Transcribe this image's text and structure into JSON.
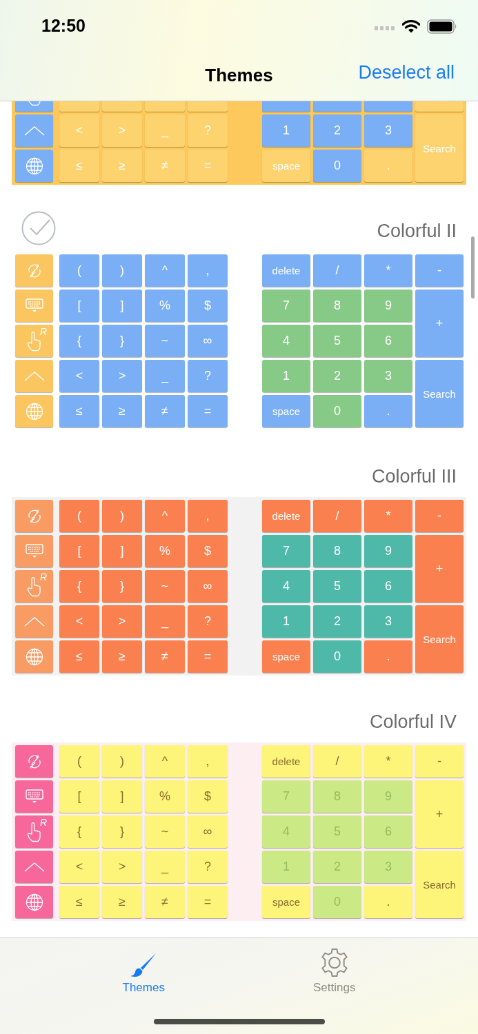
{
  "status_bar": {
    "time": "12:50"
  },
  "nav": {
    "title": "Themes",
    "action": "Deselect all"
  },
  "themes": [
    {
      "panel": {
        "color": "#fdc95c"
      },
      "dark_labels": false,
      "side_keys": [
        {
          "kind": "hand",
          "color": "#7aaff5"
        },
        {
          "kind": "shift",
          "color": "#7aaff5"
        },
        {
          "kind": "globe",
          "color": "#7aaff5"
        }
      ],
      "symbol_rows": [
        [
          {
            "color": "#fdd36f"
          },
          {
            "color": "#fdd36f"
          },
          {
            "color": "#fdd36f"
          },
          {
            "color": "#fdd36f"
          }
        ],
        [
          {
            "label": "<",
            "color": "#fdd36f"
          },
          {
            "label": ">",
            "color": "#fdd36f"
          },
          {
            "label": "_",
            "color": "#fdd36f"
          },
          {
            "label": "?",
            "color": "#fdd36f"
          }
        ],
        [
          {
            "label": "≤",
            "color": "#fdd36f"
          },
          {
            "label": "≥",
            "color": "#fdd36f"
          },
          {
            "label": "≠",
            "color": "#fdd36f"
          },
          {
            "label": "=",
            "color": "#fdd36f"
          }
        ]
      ],
      "numpad": [
        {
          "kind": "digit",
          "color": "#7aaff5"
        },
        {
          "kind": "digit",
          "color": "#7aaff5"
        },
        {
          "kind": "digit",
          "color": "#7aaff5"
        },
        {
          "kind": "other",
          "color": "#fdd36f"
        },
        {
          "kind": "digit",
          "label": "1",
          "color": "#7aaff5"
        },
        {
          "kind": "digit",
          "label": "2",
          "color": "#7aaff5"
        },
        {
          "kind": "digit",
          "label": "3",
          "color": "#7aaff5"
        },
        {
          "kind": "other",
          "label": "Search",
          "tall": true,
          "color": "#fdd36f"
        },
        {
          "kind": "other",
          "label": "space",
          "color": "#fdd36f"
        },
        {
          "kind": "digit",
          "label": "0",
          "color": "#7aaff5"
        },
        {
          "kind": "other",
          "label": ".",
          "color": "#fdd36f"
        }
      ]
    },
    {
      "name": "Colorful II",
      "selected": true,
      "panel": {
        "color": "#ffffff"
      },
      "dark_labels": false,
      "side_keys": [
        {
          "kind": "theme",
          "color": "#fbc65f"
        },
        {
          "kind": "keyboard",
          "color": "#fbc65f"
        },
        {
          "kind": "hand",
          "badge": "R",
          "color": "#fbc65f"
        },
        {
          "kind": "shift",
          "color": "#fbc65f"
        },
        {
          "kind": "globe",
          "color": "#fbc65f"
        }
      ],
      "symbol_rows": [
        [
          {
            "label": "(",
            "color": "#7aaff5"
          },
          {
            "label": ")",
            "color": "#7aaff5"
          },
          {
            "label": "^",
            "color": "#7aaff5"
          },
          {
            "label": ",",
            "color": "#7aaff5"
          }
        ],
        [
          {
            "label": "[",
            "color": "#7aaff5"
          },
          {
            "label": "]",
            "color": "#7aaff5"
          },
          {
            "label": "%",
            "color": "#7aaff5"
          },
          {
            "label": "$",
            "color": "#7aaff5"
          }
        ],
        [
          {
            "label": "{",
            "color": "#7aaff5"
          },
          {
            "label": "}",
            "color": "#7aaff5"
          },
          {
            "label": "~",
            "color": "#7aaff5"
          },
          {
            "label": "∞",
            "color": "#7aaff5"
          }
        ],
        [
          {
            "label": "<",
            "color": "#7aaff5"
          },
          {
            "label": ">",
            "color": "#7aaff5"
          },
          {
            "label": "_",
            "color": "#7aaff5"
          },
          {
            "label": "?",
            "color": "#7aaff5"
          }
        ],
        [
          {
            "label": "≤",
            "color": "#7aaff5"
          },
          {
            "label": "≥",
            "color": "#7aaff5"
          },
          {
            "label": "≠",
            "color": "#7aaff5"
          },
          {
            "label": "=",
            "color": "#7aaff5"
          }
        ]
      ],
      "numpad": [
        {
          "kind": "other",
          "label": "delete",
          "color": "#7aaff5"
        },
        {
          "kind": "other",
          "label": "/",
          "color": "#7aaff5"
        },
        {
          "kind": "other",
          "label": "*",
          "color": "#7aaff5"
        },
        {
          "kind": "other",
          "label": "-",
          "color": "#7aaff5"
        },
        {
          "kind": "digit",
          "label": "7",
          "color": "#87c987"
        },
        {
          "kind": "digit",
          "label": "8",
          "color": "#87c987"
        },
        {
          "kind": "digit",
          "label": "9",
          "color": "#87c987"
        },
        {
          "kind": "other",
          "label": "+",
          "tall": true,
          "color": "#7aaff5"
        },
        {
          "kind": "digit",
          "label": "4",
          "color": "#87c987"
        },
        {
          "kind": "digit",
          "label": "5",
          "color": "#87c987"
        },
        {
          "kind": "digit",
          "label": "6",
          "color": "#87c987"
        },
        {
          "kind": "digit",
          "label": "1",
          "color": "#87c987"
        },
        {
          "kind": "digit",
          "label": "2",
          "color": "#87c987"
        },
        {
          "kind": "digit",
          "label": "3",
          "color": "#87c987"
        },
        {
          "kind": "other",
          "label": "Search",
          "tall": true,
          "color": "#7aaff5"
        },
        {
          "kind": "other",
          "label": "space",
          "color": "#7aaff5"
        },
        {
          "kind": "digit",
          "label": "0",
          "color": "#87c987"
        },
        {
          "kind": "other",
          "label": ".",
          "color": "#7aaff5"
        }
      ]
    },
    {
      "name": "Colorful III",
      "selected": false,
      "panel": {
        "color": "#f2f2f2"
      },
      "dark_labels": false,
      "side_keys": [
        {
          "kind": "theme",
          "color": "#f99c64"
        },
        {
          "kind": "keyboard",
          "color": "#f99c64"
        },
        {
          "kind": "hand",
          "badge": "R",
          "color": "#f99c64"
        },
        {
          "kind": "shift",
          "color": "#f99c64"
        },
        {
          "kind": "globe",
          "color": "#f99c64"
        }
      ],
      "symbol_rows": [
        [
          {
            "label": "(",
            "color": "#fb8050"
          },
          {
            "label": ")",
            "color": "#fb8050"
          },
          {
            "label": "^",
            "color": "#fb8050"
          },
          {
            "label": ",",
            "color": "#fb8050"
          }
        ],
        [
          {
            "label": "[",
            "color": "#fb8050"
          },
          {
            "label": "]",
            "color": "#fb8050"
          },
          {
            "label": "%",
            "color": "#fb8050"
          },
          {
            "label": "$",
            "color": "#fb8050"
          }
        ],
        [
          {
            "label": "{",
            "color": "#fb8050"
          },
          {
            "label": "}",
            "color": "#fb8050"
          },
          {
            "label": "~",
            "color": "#fb8050"
          },
          {
            "label": "∞",
            "color": "#fb8050"
          }
        ],
        [
          {
            "label": "<",
            "color": "#fb8050"
          },
          {
            "label": ">",
            "color": "#fb8050"
          },
          {
            "label": "_",
            "color": "#fb8050"
          },
          {
            "label": "?",
            "color": "#fb8050"
          }
        ],
        [
          {
            "label": "≤",
            "color": "#fb8050"
          },
          {
            "label": "≥",
            "color": "#fb8050"
          },
          {
            "label": "≠",
            "color": "#fb8050"
          },
          {
            "label": "=",
            "color": "#fb8050"
          }
        ]
      ],
      "numpad": [
        {
          "kind": "other",
          "label": "delete",
          "color": "#fb8050"
        },
        {
          "kind": "other",
          "label": "/",
          "color": "#fb8050"
        },
        {
          "kind": "other",
          "label": "*",
          "color": "#fb8050"
        },
        {
          "kind": "other",
          "label": "-",
          "color": "#fb8050"
        },
        {
          "kind": "digit",
          "label": "7",
          "color": "#4fb9a9"
        },
        {
          "kind": "digit",
          "label": "8",
          "color": "#4fb9a9"
        },
        {
          "kind": "digit",
          "label": "9",
          "color": "#4fb9a9"
        },
        {
          "kind": "other",
          "label": "+",
          "tall": true,
          "color": "#fb8050"
        },
        {
          "kind": "digit",
          "label": "4",
          "color": "#4fb9a9"
        },
        {
          "kind": "digit",
          "label": "5",
          "color": "#4fb9a9"
        },
        {
          "kind": "digit",
          "label": "6",
          "color": "#4fb9a9"
        },
        {
          "kind": "digit",
          "label": "1",
          "color": "#4fb9a9"
        },
        {
          "kind": "digit",
          "label": "2",
          "color": "#4fb9a9"
        },
        {
          "kind": "digit",
          "label": "3",
          "color": "#4fb9a9"
        },
        {
          "kind": "other",
          "label": "Search",
          "tall": true,
          "color": "#fb8050"
        },
        {
          "kind": "other",
          "label": "space",
          "color": "#fb8050"
        },
        {
          "kind": "digit",
          "label": "0",
          "color": "#4fb9a9"
        },
        {
          "kind": "other",
          "label": ".",
          "color": "#fb8050"
        }
      ]
    },
    {
      "name": "Colorful IV",
      "selected": false,
      "panel": {
        "color": "#fdeef2"
      },
      "dark_labels": true,
      "side_keys": [
        {
          "kind": "theme",
          "color": "#f7679a"
        },
        {
          "kind": "keyboard",
          "color": "#f7679a"
        },
        {
          "kind": "hand",
          "badge": "R",
          "color": "#f7679a"
        },
        {
          "kind": "shift",
          "color": "#f7679a"
        },
        {
          "kind": "globe",
          "color": "#f7679a"
        }
      ],
      "symbol_rows": [
        [
          {
            "label": "(",
            "color": "#fdf57a"
          },
          {
            "label": ")",
            "color": "#fdf57a"
          },
          {
            "label": "^",
            "color": "#fdf57a"
          },
          {
            "label": ",",
            "color": "#fdf57a"
          }
        ],
        [
          {
            "label": "[",
            "color": "#fdf57a"
          },
          {
            "label": "]",
            "color": "#fdf57a"
          },
          {
            "label": "%",
            "color": "#fdf57a"
          },
          {
            "label": "$",
            "color": "#fdf57a"
          }
        ],
        [
          {
            "label": "{",
            "color": "#fdf57a"
          },
          {
            "label": "}",
            "color": "#fdf57a"
          },
          {
            "label": "~",
            "color": "#fdf57a"
          },
          {
            "label": "∞",
            "color": "#fdf57a"
          }
        ],
        [
          {
            "label": "<",
            "color": "#fdf57a"
          },
          {
            "label": ">",
            "color": "#fdf57a"
          },
          {
            "label": "_",
            "color": "#fdf57a"
          },
          {
            "label": "?",
            "color": "#fdf57a"
          }
        ],
        [
          {
            "label": "≤",
            "color": "#fdf57a"
          },
          {
            "label": "≥",
            "color": "#fdf57a"
          },
          {
            "label": "≠",
            "color": "#fdf57a"
          },
          {
            "label": "=",
            "color": "#fdf57a"
          }
        ]
      ],
      "numpad": [
        {
          "kind": "other",
          "label": "delete",
          "color": "#fdf57a"
        },
        {
          "kind": "other",
          "label": "/",
          "color": "#fdf57a"
        },
        {
          "kind": "other",
          "label": "*",
          "color": "#fdf57a"
        },
        {
          "kind": "other",
          "label": "-",
          "color": "#fdf57a"
        },
        {
          "kind": "digit",
          "label": "7",
          "color": "#cbe985"
        },
        {
          "kind": "digit",
          "label": "8",
          "color": "#cbe985"
        },
        {
          "kind": "digit",
          "label": "9",
          "color": "#cbe985"
        },
        {
          "kind": "other",
          "label": "+",
          "tall": true,
          "color": "#fdf57a"
        },
        {
          "kind": "digit",
          "label": "4",
          "color": "#cbe985"
        },
        {
          "kind": "digit",
          "label": "5",
          "color": "#cbe985"
        },
        {
          "kind": "digit",
          "label": "6",
          "color": "#cbe985"
        },
        {
          "kind": "digit",
          "label": "1",
          "color": "#cbe985"
        },
        {
          "kind": "digit",
          "label": "2",
          "color": "#cbe985"
        },
        {
          "kind": "digit",
          "label": "3",
          "color": "#cbe985"
        },
        {
          "kind": "other",
          "label": "Search",
          "tall": true,
          "color": "#fdf57a"
        },
        {
          "kind": "other",
          "label": "space",
          "color": "#fdf57a"
        },
        {
          "kind": "digit",
          "label": "0",
          "color": "#cbe985"
        },
        {
          "kind": "other",
          "label": ".",
          "color": "#fdf57a"
        }
      ]
    }
  ],
  "tabs": [
    {
      "label": "Themes",
      "kind": "brush",
      "selected": true
    },
    {
      "label": "Settings",
      "kind": "gear",
      "selected": false
    }
  ]
}
